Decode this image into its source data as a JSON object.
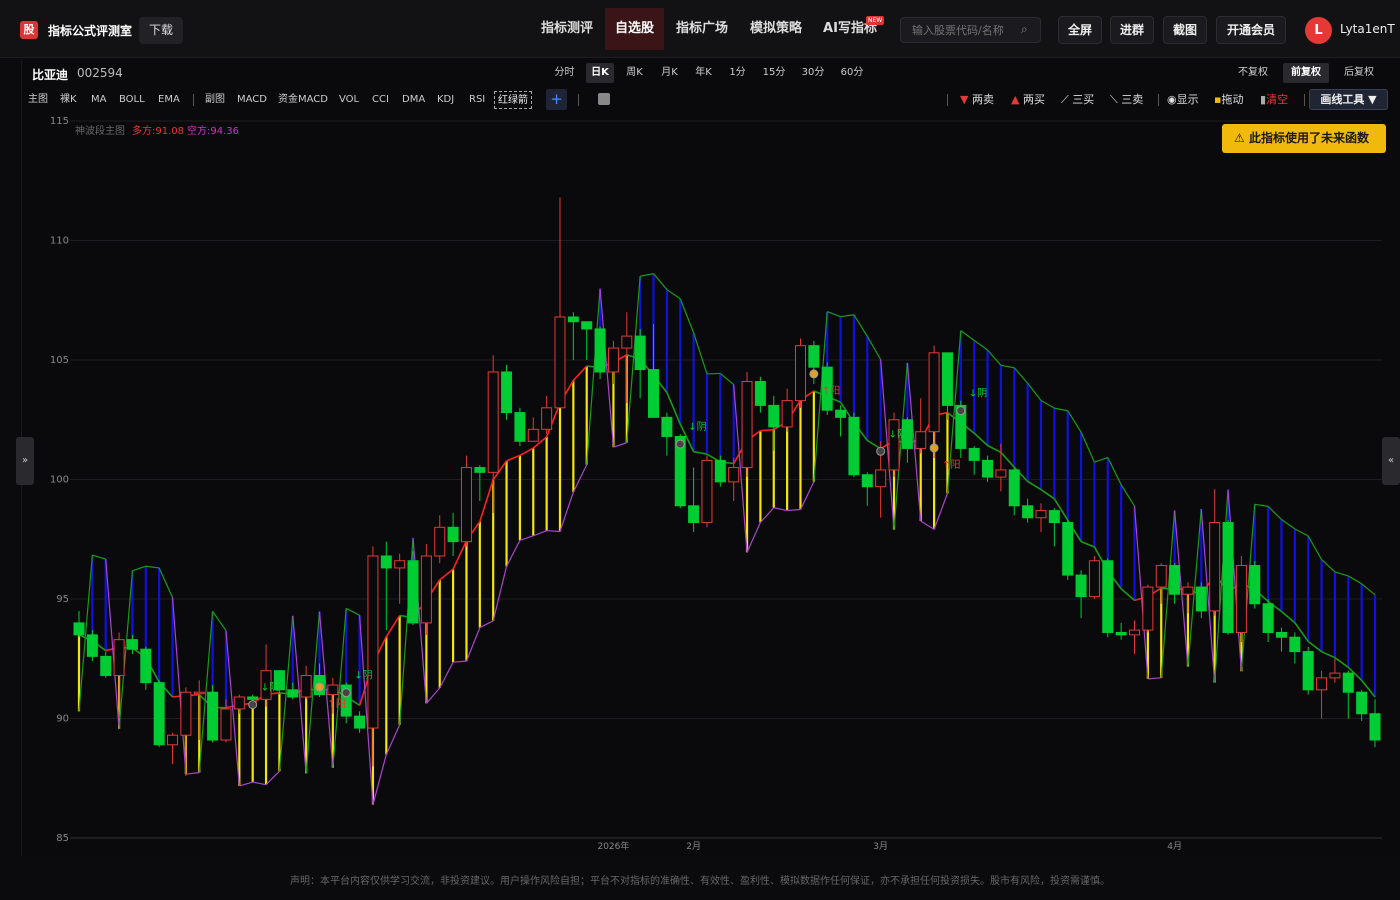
{
  "header": {
    "logo_char": "股",
    "brand": "指标公式评测室",
    "download": "下载",
    "nav": [
      {
        "label": "指标测评",
        "active": false
      },
      {
        "label": "自选股",
        "active": true
      },
      {
        "label": "指标广场",
        "active": false
      },
      {
        "label": "模拟策略",
        "active": false
      },
      {
        "label": "AI写指标",
        "active": false
      }
    ],
    "new_badge": "NEW",
    "search_placeholder": "输入股票代码/名称",
    "buttons": [
      "全屏",
      "进群",
      "截图",
      "开通会员"
    ],
    "avatar_letter": "L",
    "username": "Lyta1enT"
  },
  "stock": {
    "name": "比亚迪",
    "code": "002594"
  },
  "periods": [
    {
      "label": "分时",
      "active": false
    },
    {
      "label": "日K",
      "active": true
    },
    {
      "label": "周K",
      "active": false
    },
    {
      "label": "月K",
      "active": false
    },
    {
      "label": "年K",
      "active": false
    },
    {
      "label": "1分",
      "active": false
    },
    {
      "label": "15分",
      "active": false
    },
    {
      "label": "30分",
      "active": false
    },
    {
      "label": "60分",
      "active": false
    }
  ],
  "adjust": [
    {
      "label": "不复权",
      "active": false
    },
    {
      "label": "前复权",
      "active": true
    },
    {
      "label": "后复权",
      "active": false
    }
  ],
  "indicators": [
    "主图",
    "裸K",
    "MA",
    "BOLL",
    "EMA",
    "副图",
    "MACD",
    "资金MACD",
    "VOL",
    "CCI",
    "DMA",
    "KDJ",
    "RSI",
    "红绿箭"
  ],
  "tools": [
    {
      "label": "两卖",
      "icon": "down-triangle-icon",
      "color": "#e53935"
    },
    {
      "label": "两买",
      "icon": "up-triangle-icon",
      "color": "#e53935"
    },
    {
      "label": "三买",
      "icon": "line-chart-icon",
      "color": "#ddd"
    },
    {
      "label": "三卖",
      "icon": "line-chart-icon",
      "color": "#ddd"
    },
    {
      "label": "显示",
      "icon": "eye-icon",
      "color": "#ddd"
    },
    {
      "label": "拖动",
      "icon": "lock-icon",
      "color": "#ddd"
    },
    {
      "label": "清空",
      "icon": "trash-icon",
      "color": "#e53935"
    }
  ],
  "draw_tool": "画线工具 ▼",
  "warning": "此指标使用了未来函数",
  "left_tab": "»",
  "right_tab": "«",
  "footer": "声明：本平台内容仅供学习交流，非投资建议。用户操作风险自担；平台不对指标的准确性、有效性、盈利性、模拟数据作任何保证，亦不承担任何投资损失。股市有风险，投资需谨慎。",
  "chart_data": {
    "type": "candlestick",
    "indicator_name": "神波段主图",
    "long_label": "多方:91.08",
    "short_label": "空方:94.36",
    "ylim": [
      85,
      115
    ],
    "yticks": [
      85,
      90,
      95,
      100,
      105,
      110,
      115
    ],
    "xlabels": [
      {
        "label": "2026年",
        "index": 40
      },
      {
        "label": "2月",
        "index": 46
      },
      {
        "label": "3月",
        "index": 60
      },
      {
        "label": "4月",
        "index": 82
      }
    ],
    "candles": [
      [
        94.0,
        93.5,
        94.5,
        93.4
      ],
      [
        93.5,
        92.6,
        93.7,
        92.4
      ],
      [
        92.6,
        91.8,
        92.8,
        91.7
      ],
      [
        91.8,
        93.3,
        93.6,
        90.0
      ],
      [
        93.3,
        92.9,
        93.5,
        92.7
      ],
      [
        92.9,
        91.5,
        93.0,
        91.2
      ],
      [
        91.5,
        88.9,
        91.6,
        88.8
      ],
      [
        88.9,
        89.3,
        89.4,
        88.1
      ],
      [
        89.3,
        91.1,
        91.3,
        87.6
      ],
      [
        91.1,
        91.1,
        91.6,
        89.1
      ],
      [
        91.1,
        89.1,
        91.4,
        89.0
      ],
      [
        89.1,
        90.4,
        90.8,
        89.0
      ],
      [
        90.4,
        90.9,
        91.0,
        90.2
      ],
      [
        90.9,
        90.8,
        91.0,
        90.7
      ],
      [
        90.8,
        92.0,
        93.1,
        90.5
      ],
      [
        92.0,
        91.2,
        92.0,
        91.0
      ],
      [
        91.2,
        90.9,
        91.5,
        90.8
      ],
      [
        90.9,
        91.8,
        92.2,
        90.8
      ],
      [
        91.8,
        91.0,
        92.3,
        90.9
      ],
      [
        91.0,
        91.4,
        91.7,
        90.2
      ],
      [
        91.4,
        90.1,
        91.5,
        89.8
      ],
      [
        90.1,
        89.6,
        90.3,
        89.4
      ],
      [
        89.6,
        96.8,
        97.2,
        88.0
      ],
      [
        96.8,
        96.3,
        97.4,
        93.7
      ],
      [
        96.3,
        96.6,
        96.9,
        94.8
      ],
      [
        96.6,
        94.0,
        97.0,
        93.9
      ],
      [
        94.0,
        96.8,
        97.3,
        93.5
      ],
      [
        96.8,
        98.0,
        98.5,
        96.5
      ],
      [
        98.0,
        97.4,
        98.6,
        96.8
      ],
      [
        97.4,
        100.5,
        101.0,
        97.2
      ],
      [
        100.5,
        100.3,
        100.6,
        99.1
      ],
      [
        100.3,
        104.5,
        105.2,
        98.6
      ],
      [
        104.5,
        102.8,
        104.8,
        102.5
      ],
      [
        102.8,
        101.6,
        103.0,
        101.4
      ],
      [
        101.6,
        102.1,
        102.6,
        101.8
      ],
      [
        102.1,
        103.0,
        103.5,
        101.9
      ],
      [
        103.0,
        106.8,
        111.8,
        104.2
      ],
      [
        106.8,
        106.6,
        107.0,
        105.0
      ],
      [
        106.6,
        106.3,
        106.6,
        105.0
      ],
      [
        106.3,
        104.5,
        106.4,
        104.2
      ],
      [
        104.5,
        105.5,
        105.8,
        104.0
      ],
      [
        105.5,
        106.0,
        107.0,
        103.2
      ],
      [
        106.0,
        104.6,
        106.3,
        103.4
      ],
      [
        104.6,
        102.6,
        106.5,
        102.6
      ],
      [
        102.6,
        101.8,
        102.8,
        101.0
      ],
      [
        101.8,
        98.9,
        101.9,
        98.8
      ],
      [
        98.9,
        98.2,
        100.5,
        97.8
      ],
      [
        98.2,
        100.8,
        101.0,
        98.0
      ],
      [
        100.8,
        99.9,
        101.0,
        99.7
      ],
      [
        99.9,
        100.5,
        100.9,
        99.1
      ],
      [
        100.5,
        104.1,
        104.5,
        100.1
      ],
      [
        104.1,
        103.1,
        104.3,
        102.8
      ],
      [
        103.1,
        102.2,
        103.5,
        101.2
      ],
      [
        102.2,
        103.3,
        103.8,
        102.0
      ],
      [
        103.3,
        105.6,
        105.9,
        103.0
      ],
      [
        105.6,
        104.7,
        105.8,
        104.0
      ],
      [
        104.7,
        102.9,
        104.9,
        102.7
      ],
      [
        102.9,
        102.6,
        103.1,
        101.8
      ],
      [
        102.6,
        100.2,
        102.8,
        100.1
      ],
      [
        100.2,
        99.7,
        100.3,
        98.9
      ],
      [
        99.7,
        100.4,
        101.6,
        98.4
      ],
      [
        100.4,
        102.5,
        102.8,
        100.1
      ],
      [
        102.5,
        101.3,
        102.6,
        100.7
      ],
      [
        101.3,
        102.0,
        103.4,
        101.1
      ],
      [
        102.0,
        105.3,
        105.6,
        100.9
      ],
      [
        105.3,
        103.1,
        105.2,
        102.5
      ],
      [
        103.1,
        101.3,
        103.3,
        100.9
      ],
      [
        101.3,
        100.8,
        101.4,
        100.2
      ],
      [
        100.8,
        100.1,
        101.0,
        99.9
      ],
      [
        100.1,
        100.4,
        101.5,
        99.5
      ],
      [
        100.4,
        98.9,
        100.5,
        98.5
      ],
      [
        98.9,
        98.4,
        99.2,
        98.2
      ],
      [
        98.4,
        98.7,
        99.0,
        97.8
      ],
      [
        98.7,
        98.2,
        98.8,
        97.2
      ],
      [
        98.2,
        96.0,
        98.3,
        95.8
      ],
      [
        96.0,
        95.1,
        96.2,
        94.2
      ],
      [
        95.1,
        96.6,
        96.8,
        95.0
      ],
      [
        96.6,
        93.6,
        96.7,
        93.4
      ],
      [
        93.6,
        93.5,
        94.0,
        93.3
      ],
      [
        93.5,
        93.7,
        94.1,
        92.7
      ],
      [
        93.7,
        95.5,
        95.6,
        93.6
      ],
      [
        95.5,
        96.4,
        96.5,
        94.8
      ],
      [
        96.4,
        95.2,
        96.5,
        94.8
      ],
      [
        95.2,
        95.5,
        95.7,
        94.4
      ],
      [
        95.5,
        94.5,
        95.7,
        94.2
      ],
      [
        94.5,
        98.2,
        99.6,
        94.3
      ],
      [
        98.2,
        93.6,
        98.3,
        93.5
      ],
      [
        93.6,
        96.4,
        96.8,
        93.2
      ],
      [
        96.4,
        94.8,
        96.6,
        94.6
      ],
      [
        94.8,
        93.6,
        95.0,
        93.2
      ],
      [
        93.6,
        93.4,
        93.8,
        92.8
      ],
      [
        93.4,
        92.8,
        93.6,
        92.3
      ],
      [
        92.8,
        91.2,
        93.0,
        91.0
      ],
      [
        91.2,
        91.7,
        92.0,
        90.0
      ],
      [
        91.7,
        91.9,
        92.5,
        91.5
      ],
      [
        91.9,
        91.1,
        92.0,
        90.0
      ],
      [
        91.1,
        90.2,
        91.2,
        89.9
      ],
      [
        90.2,
        89.1,
        90.8,
        88.8
      ]
    ],
    "markers": [
      {
        "index": 13,
        "text": "↓阴",
        "color": "#00cc33"
      },
      {
        "index": 18,
        "text": "↑阳",
        "color": "#e53935"
      },
      {
        "index": 20,
        "text": "↓阴",
        "color": "#00cc33"
      },
      {
        "index": 45,
        "text": "↓阴",
        "color": "#00cc33"
      },
      {
        "index": 55,
        "text": "↑阳",
        "color": "#e53935"
      },
      {
        "index": 60,
        "text": "↓阴",
        "color": "#00cc33"
      },
      {
        "index": 64,
        "text": "↑阳",
        "color": "#e53935"
      },
      {
        "index": 66,
        "text": "↓阴",
        "color": "#00cc33"
      }
    ]
  }
}
